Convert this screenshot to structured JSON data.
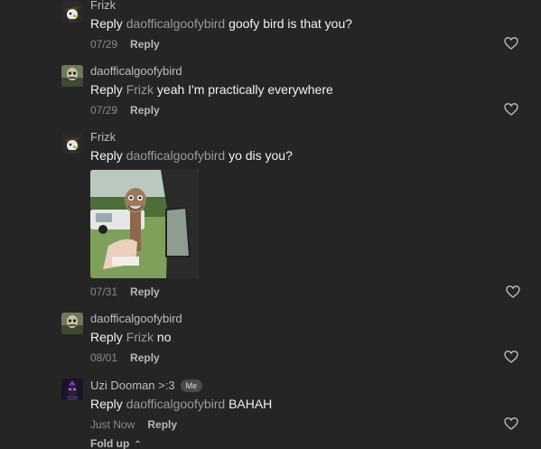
{
  "comments": [
    {
      "username": "Frizk",
      "reply_word": "Reply",
      "mention": "daofficalgoofybird",
      "text": "goofy bird is that you?",
      "date": "07/29",
      "reply_label": "Reply",
      "avatar_icon": "bird-cowboy-avatar-icon"
    },
    {
      "username": "daofficalgoofybird",
      "reply_word": "Reply",
      "mention": "Frizk",
      "text": "yeah I'm practically everywhere",
      "date": "07/29",
      "reply_label": "Reply",
      "avatar_icon": "goofy-bird-avatar-icon"
    },
    {
      "username": "Frizk",
      "reply_word": "Reply",
      "mention": "daofficalgoofybird",
      "text": "yo dis you?",
      "date": "07/31",
      "reply_label": "Reply",
      "avatar_icon": "bird-cowboy-avatar-icon",
      "has_image": true
    },
    {
      "username": "daofficalgoofybird",
      "reply_word": "Reply",
      "mention": "Frizk",
      "text": "no",
      "date": "08/01",
      "reply_label": "Reply",
      "avatar_icon": "goofy-bird-avatar-icon"
    },
    {
      "username": "Uzi Dooman >:3",
      "badge": "Me",
      "reply_word": "Reply",
      "mention": "daofficalgoofybird",
      "text": "BAHAH",
      "date": "Just Now",
      "reply_label": "Reply",
      "avatar_icon": "uzi-avatar-icon"
    }
  ],
  "fold_up_label": "Fold up",
  "colors": {
    "background": "#252525",
    "text": "#f2f2f2",
    "mention": "#9a9a9a",
    "meta": "#8a8a8a"
  }
}
